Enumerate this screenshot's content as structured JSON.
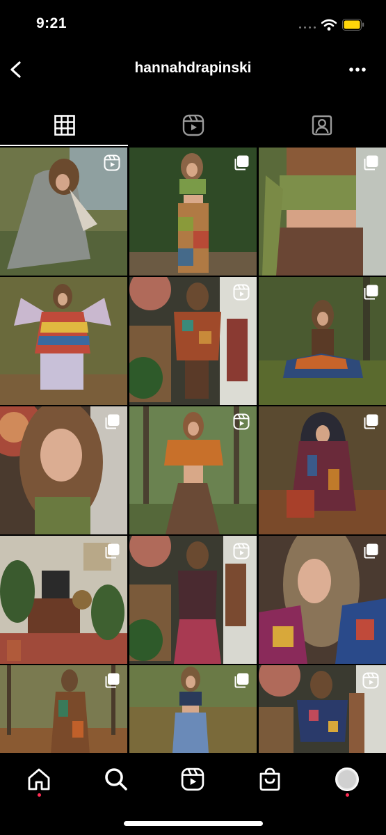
{
  "status_bar": {
    "time": "9:21",
    "battery_color": "#FFD60A"
  },
  "header": {
    "title": "hannahdrapinski",
    "back_icon": "chevron-left-icon",
    "more_icon": "more-horizontal-icon"
  },
  "tabs": [
    {
      "name": "grid",
      "icon": "grid-icon",
      "selected": true
    },
    {
      "name": "reels",
      "icon": "reels-icon",
      "selected": false
    },
    {
      "name": "tagged",
      "icon": "tagged-person-icon",
      "selected": false
    }
  ],
  "posts": [
    {
      "type": "reel",
      "subject": "woman crouching by a pond in a lace shawl"
    },
    {
      "type": "carousel",
      "subject": "patchwork pants and green crop top in front of hedge"
    },
    {
      "type": "carousel",
      "subject": "green lace-up top and brown skirt"
    },
    {
      "type": "image",
      "subject": "fairy wings and rainbow poncho in autumn forest"
    },
    {
      "type": "reel",
      "subject": "mirror selfie in patchwork jacket"
    },
    {
      "type": "carousel",
      "subject": "sitting cross-legged in the woods"
    },
    {
      "type": "carousel",
      "subject": "close-up portrait with long wavy hair"
    },
    {
      "type": "reel",
      "subject": "orange tie top and long brown skirt"
    },
    {
      "type": "carousel",
      "subject": "hooded patterned cardigan in autumn leaves"
    },
    {
      "type": "carousel",
      "subject": "boho living room with plants"
    },
    {
      "type": "reel",
      "subject": "mirror selfie in velvet top and pink skirt"
    },
    {
      "type": "carousel",
      "subject": "close-up with colorful patchwork jacket"
    },
    {
      "type": "carousel",
      "subject": "patchwork cardigan on forest path"
    },
    {
      "type": "carousel",
      "subject": "blue tiered skirt outdoors"
    },
    {
      "type": "reel",
      "subject": "mirror selfie in denim outfit"
    }
  ],
  "bottom_nav": [
    {
      "name": "home",
      "icon": "home-icon",
      "notification_dot": true
    },
    {
      "name": "search",
      "icon": "search-icon",
      "notification_dot": false
    },
    {
      "name": "reels",
      "icon": "reels-icon",
      "notification_dot": false
    },
    {
      "name": "shop",
      "icon": "shopping-bag-icon",
      "notification_dot": false
    },
    {
      "name": "profile",
      "icon": "profile-avatar",
      "notification_dot": true
    }
  ],
  "colors": {
    "background": "#000000",
    "notification": "#FF2D55",
    "text": "#FFFFFF"
  }
}
